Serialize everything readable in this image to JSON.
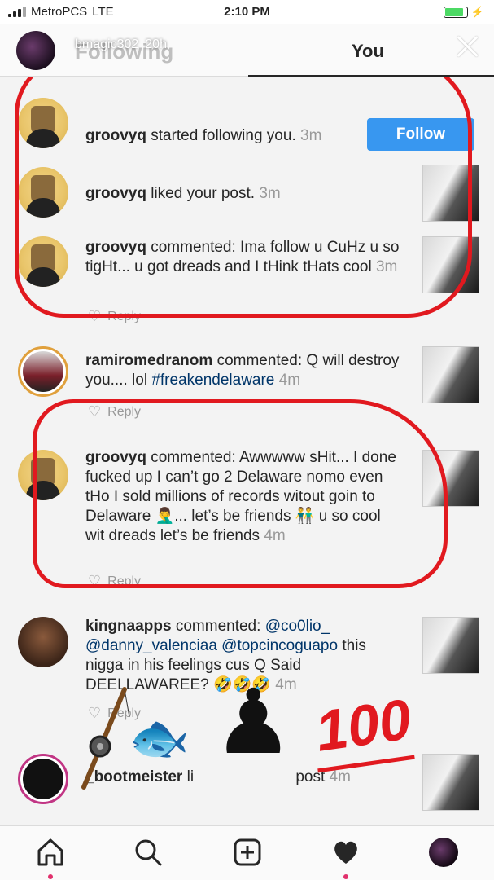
{
  "status_bar": {
    "carrier": "MetroPCS",
    "network": "LTE",
    "time": "2:10 PM"
  },
  "story_header": {
    "username": "bmagic302",
    "time_ago": "20h",
    "close_icon": "close-icon"
  },
  "tabs": {
    "following": "Following",
    "you": "You"
  },
  "activity": [
    {
      "user": "groovyq",
      "action": "started following you.",
      "time": "3m",
      "button": "Follow"
    },
    {
      "user": "groovyq",
      "action": "liked your post.",
      "time": "3m"
    },
    {
      "user": "groovyq",
      "action": "commented: Ima follow u CuHz u so tigHt... u got dreads and I tHink tHats cool",
      "time": "3m",
      "reply": "Reply"
    },
    {
      "user": "ramiromedranom",
      "action": "commented: Q will destroy you.... lol",
      "hashtag": "#freakendelaware",
      "time": "4m",
      "reply": "Reply"
    },
    {
      "user": "groovyq",
      "action": "commented: Awwwww sHit... I done fucked up I can’t go 2 Delaware nomo even tHo I sold millions of records witout goin to Delaware 🤦‍♂️... let’s be friends 👬 u so cool wit dreads let’s be friends",
      "time": "4m",
      "reply": "Reply"
    },
    {
      "user": "kingnaapps",
      "action": "commented:",
      "mentions": "@co0lio_ @danny_valenciaa @topcincoguapo",
      "rest": "this nigga in his feelings cus Q Said DEELLAWAREE? 🤣🤣🤣",
      "time": "4m",
      "reply": "Reply"
    },
    {
      "user": "_bootmeister",
      "action": "li",
      "rest": "post",
      "time": "4m"
    }
  ],
  "stickers": {
    "hundred": "100"
  },
  "nav": [
    "home-icon",
    "search-icon",
    "add-icon",
    "heart-icon",
    "profile-icon"
  ],
  "colors": {
    "follow_button": "#3897f0",
    "annotation_red": "#e1191f"
  }
}
